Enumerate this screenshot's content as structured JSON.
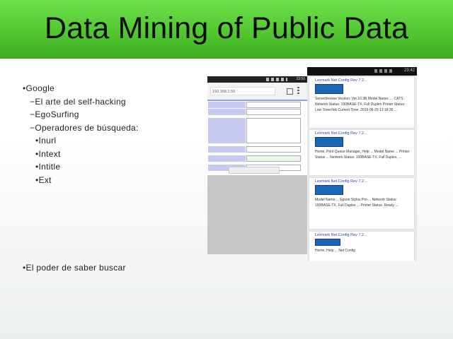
{
  "slide": {
    "title": "Data Mining of Public Data",
    "bullets": [
      {
        "level": 1,
        "text": "Google"
      },
      {
        "level": 2,
        "text": "El arte del self-hacking"
      },
      {
        "level": 2,
        "text": "EgoSurfing"
      },
      {
        "level": 2,
        "text": "Operadores de búsqueda:"
      },
      {
        "level": 3,
        "text": "Inurl"
      },
      {
        "level": 3,
        "text": "Intext"
      },
      {
        "level": 3,
        "text": "Intitle"
      },
      {
        "level": 3,
        "text": "Ext"
      }
    ],
    "final_bullet": "El poder de saber buscar"
  },
  "screenshot_left": {
    "url": "192.168.1.50",
    "clock": "23:50"
  },
  "screenshot_right": {
    "clock": "23:42",
    "cards": [
      {
        "head": "Lexmark Net Config",
        "version": "Rev 7.2...",
        "text": "Serverbrowse Version: Ver.10.3B Model Name: ... CATS Network Status: 100BASE-TX, Full Duplex Printer Status: Low Toner/Ink Current Time: 2016-06-29 12:18:35 ..."
      },
      {
        "head": "Lexmark Net Config",
        "version": "Rev 7.2...",
        "text": "Home, Print Queue Manager, Help ... Model Name ... Printer Status ... Network Status: 100BASE-TX, Full Duplex, ..."
      },
      {
        "head": "Lexmark Net Config",
        "version": "Rev 7.2...",
        "text": "Model Name ... Epson Stylus Pro ... Network Status: 100BASE-TX, Full Duplex ... Printer Status: Ready ..."
      },
      {
        "head": "Lexmark Net Config",
        "version": "Rev 7.2...",
        "text": "Home, Help ... Net Config"
      }
    ]
  },
  "colors": {
    "title_bar": "#4fc52e",
    "link_blue": "#2c3eb0"
  }
}
